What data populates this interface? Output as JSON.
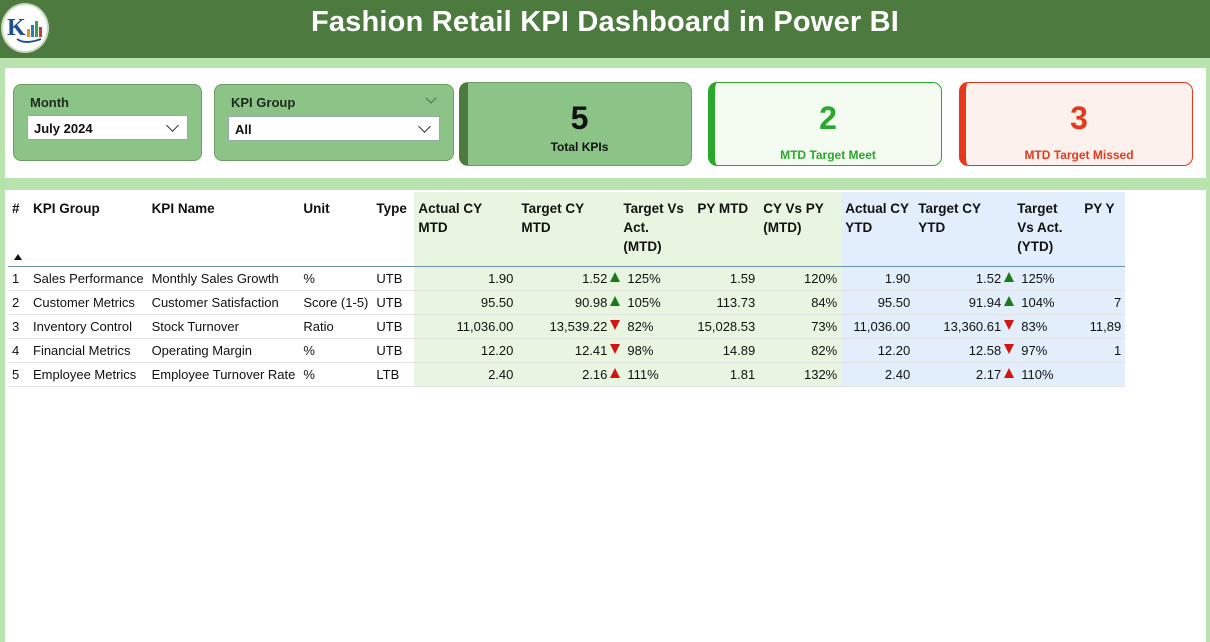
{
  "header": {
    "title": "Fashion Retail KPI Dashboard in Power BI",
    "logo_icon": "bar-chart-logo-icon",
    "bg_color": "#4d7a3e"
  },
  "slicers": {
    "month": {
      "label": "Month",
      "value": "July 2024"
    },
    "kpi_group": {
      "label": "KPI Group",
      "value": "All"
    }
  },
  "cards": {
    "total": {
      "value": "5",
      "label": "Total KPIs",
      "color": "#8cc488"
    },
    "met": {
      "value": "2",
      "label": "MTD Target Meet",
      "color": "#2aa82a"
    },
    "missed": {
      "value": "3",
      "label": "MTD Target Missed",
      "color": "#e5391d"
    }
  },
  "table": {
    "columns": [
      "#",
      "KPI Group",
      "KPI Name",
      "Unit",
      "Type",
      "Actual CY MTD",
      "Target CY MTD",
      "Target Vs Act. (MTD)",
      "PY MTD",
      "CY Vs PY (MTD)",
      "Actual CY YTD",
      "Target CY YTD",
      "Target Vs Act. (YTD)",
      "PY Y"
    ],
    "rows": [
      {
        "n": "1",
        "group": "Sales Performance",
        "name": "Monthly Sales Growth",
        "unit": "%",
        "type": "UTB",
        "act_mtd": "1.90",
        "tgt_mtd": "1.52",
        "mtd_icon": "up-green",
        "mtd_pct": "125%",
        "py_mtd": "1.59",
        "cy_py": "120%",
        "act_ytd": "1.90",
        "tgt_ytd": "1.52",
        "ytd_icon": "up-green",
        "ytd_pct": "125%",
        "py_ytd": ""
      },
      {
        "n": "2",
        "group": "Customer Metrics",
        "name": "Customer Satisfaction",
        "unit": "Score (1-5)",
        "type": "UTB",
        "act_mtd": "95.50",
        "tgt_mtd": "90.98",
        "mtd_icon": "up-green",
        "mtd_pct": "105%",
        "py_mtd": "113.73",
        "cy_py": "84%",
        "act_ytd": "95.50",
        "tgt_ytd": "91.94",
        "ytd_icon": "up-green",
        "ytd_pct": "104%",
        "py_ytd": "7"
      },
      {
        "n": "3",
        "group": "Inventory Control",
        "name": "Stock Turnover",
        "unit": "Ratio",
        "type": "UTB",
        "act_mtd": "11,036.00",
        "tgt_mtd": "13,539.22",
        "mtd_icon": "down-red",
        "mtd_pct": "82%",
        "py_mtd": "15,028.53",
        "cy_py": "73%",
        "act_ytd": "11,036.00",
        "tgt_ytd": "13,360.61",
        "ytd_icon": "down-red",
        "ytd_pct": "83%",
        "py_ytd": "11,89"
      },
      {
        "n": "4",
        "group": "Financial Metrics",
        "name": "Operating Margin",
        "unit": "%",
        "type": "UTB",
        "act_mtd": "12.20",
        "tgt_mtd": "12.41",
        "mtd_icon": "down-red",
        "mtd_pct": "98%",
        "py_mtd": "14.89",
        "cy_py": "82%",
        "act_ytd": "12.20",
        "tgt_ytd": "12.58",
        "ytd_icon": "down-red",
        "ytd_pct": "97%",
        "py_ytd": "1"
      },
      {
        "n": "5",
        "group": "Employee Metrics",
        "name": "Employee Turnover Rate",
        "unit": "%",
        "type": "LTB",
        "act_mtd": "2.40",
        "tgt_mtd": "2.16",
        "mtd_icon": "up-red",
        "mtd_pct": "111%",
        "py_mtd": "1.81",
        "cy_py": "132%",
        "act_ytd": "2.40",
        "tgt_ytd": "2.17",
        "ytd_icon": "up-red",
        "ytd_pct": "110%",
        "py_ytd": ""
      }
    ]
  }
}
